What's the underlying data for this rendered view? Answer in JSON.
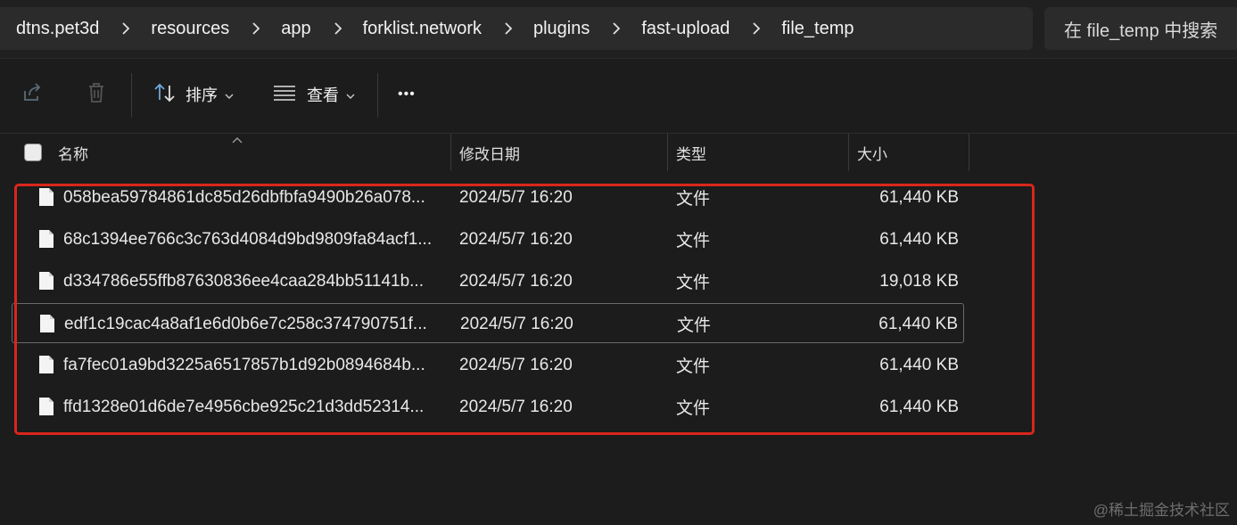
{
  "breadcrumb": {
    "items": [
      "dtns.pet3d",
      "resources",
      "app",
      "forklist.network",
      "plugins",
      "fast-upload",
      "file_temp"
    ]
  },
  "search": {
    "placeholder": "在 file_temp 中搜索"
  },
  "toolbar": {
    "sort_label": "排序",
    "view_label": "查看",
    "more_label": "•••"
  },
  "columns": {
    "name": "名称",
    "modified": "修改日期",
    "type": "类型",
    "size": "大小"
  },
  "files": [
    {
      "name": "058bea59784861dc85d26dbfbfa9490b26a078...",
      "modified": "2024/5/7 16:20",
      "type": "文件",
      "size": "61,440 KB"
    },
    {
      "name": "68c1394ee766c3c763d4084d9bd9809fa84acf1...",
      "modified": "2024/5/7 16:20",
      "type": "文件",
      "size": "61,440 KB"
    },
    {
      "name": "d334786e55ffb87630836ee4caa284bb51141b...",
      "modified": "2024/5/7 16:20",
      "type": "文件",
      "size": "19,018 KB"
    },
    {
      "name": "edf1c19cac4a8af1e6d0b6e7c258c374790751f...",
      "modified": "2024/5/7 16:20",
      "type": "文件",
      "size": "61,440 KB"
    },
    {
      "name": "fa7fec01a9bd3225a6517857b1d92b0894684b...",
      "modified": "2024/5/7 16:20",
      "type": "文件",
      "size": "61,440 KB"
    },
    {
      "name": "ffd1328e01d6de7e4956cbe925c21d3dd52314...",
      "modified": "2024/5/7 16:20",
      "type": "文件",
      "size": "61,440 KB"
    }
  ],
  "watermark": "@稀土掘金技术社区",
  "colors": {
    "highlight": "#d9261c",
    "background": "#1c1c1c"
  }
}
